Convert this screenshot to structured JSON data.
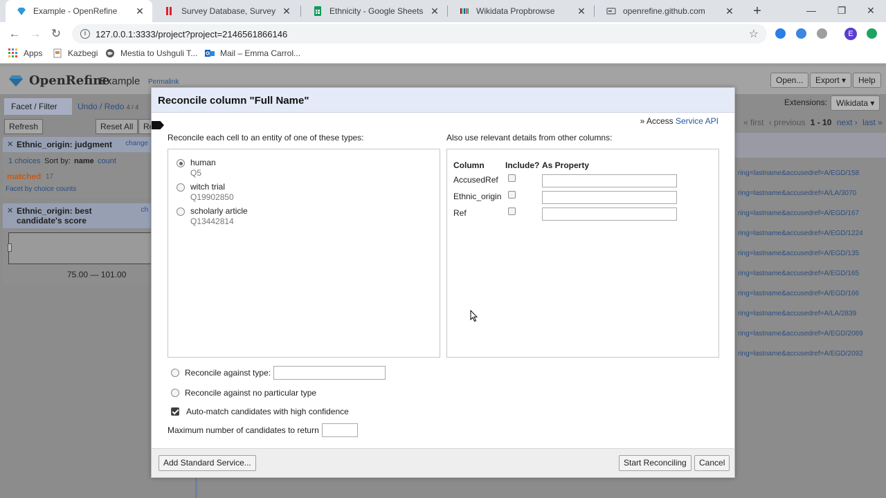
{
  "browser": {
    "tabs": [
      {
        "title": "Example - OpenRefine",
        "active": true
      },
      {
        "title": "Survey Database, Survey of Sc",
        "active": false
      },
      {
        "title": "Ethnicity - Google Sheets",
        "active": false
      },
      {
        "title": "Wikidata Propbrowse",
        "active": false
      },
      {
        "title": "openrefine.github.com",
        "active": false
      }
    ],
    "url": "127.0.0.1:3333/project?project=2146561866146",
    "avatar_letter": "E",
    "bookmarks": [
      {
        "label": "Apps",
        "icon": "apps-grid-icon"
      },
      {
        "label": "Kazbegi",
        "icon": "bookmark-page-icon"
      },
      {
        "label": "Mestia to Ushguli T...",
        "icon": "globe-icon"
      },
      {
        "label": "Mail – Emma Carrol...",
        "icon": "outlook-mail-icon"
      }
    ]
  },
  "openrefine": {
    "brand": "OpenRefine",
    "project_name": "Example",
    "permalink": "Permalink",
    "header_buttons": [
      "Open...",
      "Export ▾",
      "Help"
    ],
    "left_tabs": [
      {
        "label": "Facet / Filter"
      },
      {
        "label": "Undo / Redo",
        "count": "4 / 4"
      }
    ],
    "refresh": "Refresh",
    "reset_all": "Reset All",
    "remove_all": "Re",
    "facet1": {
      "title": "Ethnic_origin: judgment",
      "change": "change",
      "choices": "1 choices",
      "sort_by": "Sort by:",
      "sort_name": "name",
      "sort_count": "count",
      "choice_label": "matched",
      "choice_count": "17",
      "facet_by_counts": "Facet by choice counts"
    },
    "facet2": {
      "title": "Ethnic_origin: best candidate's score",
      "change": "ch",
      "range": "75.00 — 101.00"
    },
    "extensions_label": "Extensions:",
    "extensions_menu": "Wikidata ▾",
    "pager": {
      "first": "« first",
      "previous": "‹ previous",
      "range": "1 - 10",
      "next": "next ›",
      "last": "last »"
    },
    "row_links": [
      "ring=lastname&accusedref=A/EGD/158",
      "ring=lastname&accusedref=A/LA/3070",
      "ring=lastname&accusedref=A/EGD/167",
      "ring=lastname&accusedref=A/EGD/1224",
      "ring=lastname&accusedref=A/EGD/135",
      "ring=lastname&accusedref=A/EGD/165",
      "ring=lastname&accusedref=A/EGD/166",
      "ring=lastname&accusedref=A/LA/2839",
      "ring=lastname&accusedref=A/EGD/2089",
      "ring=lastname&accusedref=A/EGD/2092"
    ]
  },
  "dialog": {
    "title": "Reconcile column \"Full Name\"",
    "access_prefix": "» Access",
    "access_link": "Service API",
    "types_label": "Reconcile each cell to an entity of one of these types:",
    "types": [
      {
        "name": "human",
        "id": "Q5",
        "selected": true
      },
      {
        "name": "witch trial",
        "id": "Q19902850",
        "selected": false
      },
      {
        "name": "scholarly article",
        "id": "Q13442814",
        "selected": false
      }
    ],
    "other_cols_label": "Also use relevant details from other columns:",
    "col_headers": {
      "column": "Column",
      "include": "Include?",
      "as_property": "As Property"
    },
    "columns": [
      {
        "name": "AccusedRef",
        "include": false,
        "property": ""
      },
      {
        "name": "Ethnic_origin",
        "include": false,
        "property": ""
      },
      {
        "name": "Ref",
        "include": false,
        "property": ""
      }
    ],
    "against_type_label": "Reconcile against type:",
    "against_type_value": "",
    "no_type_label": "Reconcile against no particular type",
    "automatch_label": "Auto-match candidates with high confidence",
    "automatch_checked": true,
    "max_candidates_label": "Maximum number of candidates to return",
    "max_candidates_value": "",
    "add_service": "Add Standard Service...",
    "start": "Start Reconciling",
    "cancel": "Cancel"
  },
  "colors": {
    "link": "#2156a5",
    "dialog_header": "#e5eaf8",
    "facet_choice": "#c45a1a"
  }
}
